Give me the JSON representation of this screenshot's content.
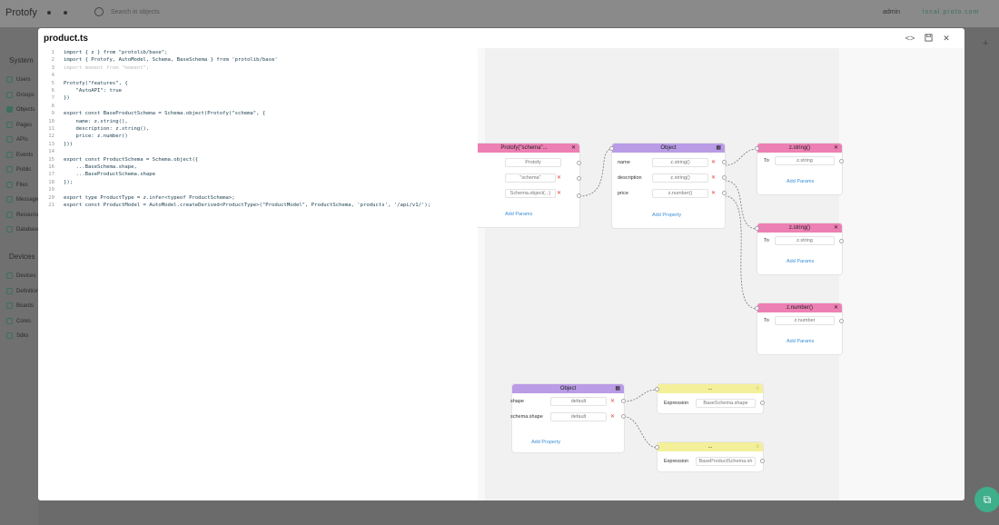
{
  "app": {
    "logo": "Protofy",
    "search_placeholder": "Search in objects",
    "user": "admin",
    "domain": "local.proto.com",
    "sidebar_system_label": "System",
    "sidebar_devices_label": "Devices",
    "sidebar_system_items": [
      "Users",
      "Groups",
      "Objects",
      "Pages",
      "APIs",
      "Events",
      "Public",
      "Files",
      "Messages",
      "Resources",
      "Databases"
    ],
    "sidebar_device_items": [
      "Devices",
      "Definitions",
      "Boards",
      "Cores",
      "Sdks"
    ],
    "active_item": "Objects",
    "plus_label": "+"
  },
  "modal": {
    "title": "product.ts",
    "code_icon": "<>",
    "save_icon": "save-icon",
    "close_icon": "✕"
  },
  "code_lines": [
    "import { z } from \"protolib/base\";",
    "import { Protofy, AutoModel, Schema, BaseSchema } from 'protolib/base'",
    "import moment from \"moment\";",
    "",
    "Protofy(\"features\", {",
    "    \"AutoAPI\": true",
    "})",
    "",
    "export const BaseProductSchema = Schema.object(Protofy(\"schema\", {",
    "    name: z.string(),",
    "    description: z.string(),",
    "    price: z.number()",
    "}))",
    "",
    "export const ProductSchema = Schema.object({",
    "    ...BaseSchema.shape,",
    "    ...BaseProductSchema.shape",
    "});",
    "",
    "export type ProductType = z.infer<typeof ProductSchema>;",
    "export const ProductModel = AutoModel.createDerived<ProductType>(\"ProductModel\", ProductSchema, 'products', '/api/v1/');"
  ],
  "flow": {
    "protofy_node": {
      "title": "Protofy(\"schema\"...",
      "values": [
        "Protofy",
        "\"schema\"",
        "Schema.object(...)"
      ],
      "add_params": "Add Params"
    },
    "object_node_1": {
      "title": "Object",
      "rows": [
        {
          "key": "name",
          "value": "z.string()"
        },
        {
          "key": "description",
          "value": "z.string()"
        },
        {
          "key": "price",
          "value": "z.number()"
        }
      ],
      "add_property": "Add Property"
    },
    "type_nodes": [
      {
        "title": "z.string()",
        "to_label": "To",
        "to_value": "z.string",
        "add_params": "Add Params"
      },
      {
        "title": "z.string()",
        "to_label": "To",
        "to_value": "z.string",
        "add_params": "Add Params"
      },
      {
        "title": "z.number()",
        "to_label": "To",
        "to_value": "z.number",
        "add_params": "Add Params"
      }
    ],
    "object_node_2": {
      "title": "Object",
      "rows": [
        {
          "key": "shape",
          "value": "default"
        },
        {
          "key": "schema.shape",
          "value": "default"
        }
      ],
      "add_property": "Add Property"
    },
    "spread_nodes": [
      {
        "title": "...",
        "expr_label": "Expression",
        "expr_value": "BaseSchema.shape"
      },
      {
        "title": "...",
        "expr_label": "Expression",
        "expr_value": "BaseProductSchema.sh"
      }
    ]
  }
}
